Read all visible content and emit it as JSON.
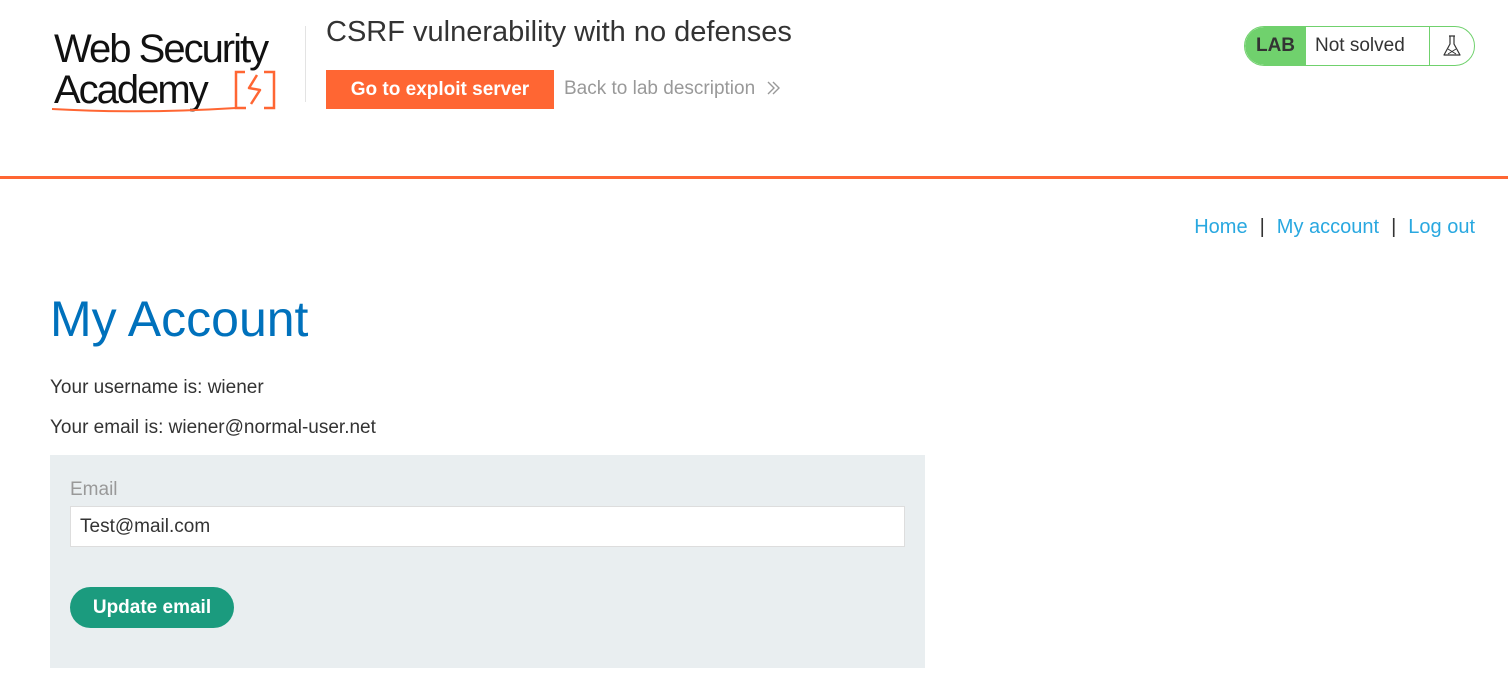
{
  "header": {
    "logo_line1": "Web Security",
    "logo_line2": "Academy",
    "lab_title": "CSRF vulnerability with no defenses",
    "exploit_button": "Go to exploit server",
    "back_link": "Back to lab description",
    "lab_badge": "LAB",
    "lab_status": "Not solved",
    "brand_color": "#ff6633",
    "status_color": "#70d16d"
  },
  "nav": {
    "home": "Home",
    "separator": "|",
    "my_account": "My account",
    "log_out": "Log out"
  },
  "main": {
    "title": "My Account",
    "username_line": "Your username is: wiener",
    "email_line": "Your email is: wiener@normal-user.net",
    "form": {
      "email_label": "Email",
      "email_value": "Test@mail.com",
      "submit_label": "Update email"
    }
  },
  "colors": {
    "title": "#0071bc",
    "link": "#29a8e0",
    "form_bg": "#e9eef0",
    "button": "#1b9b7e"
  },
  "icons": {
    "logo_mark": "lightning-bracket-icon",
    "back_chevron": "double-chevron-right-icon",
    "flask": "flask-icon"
  }
}
